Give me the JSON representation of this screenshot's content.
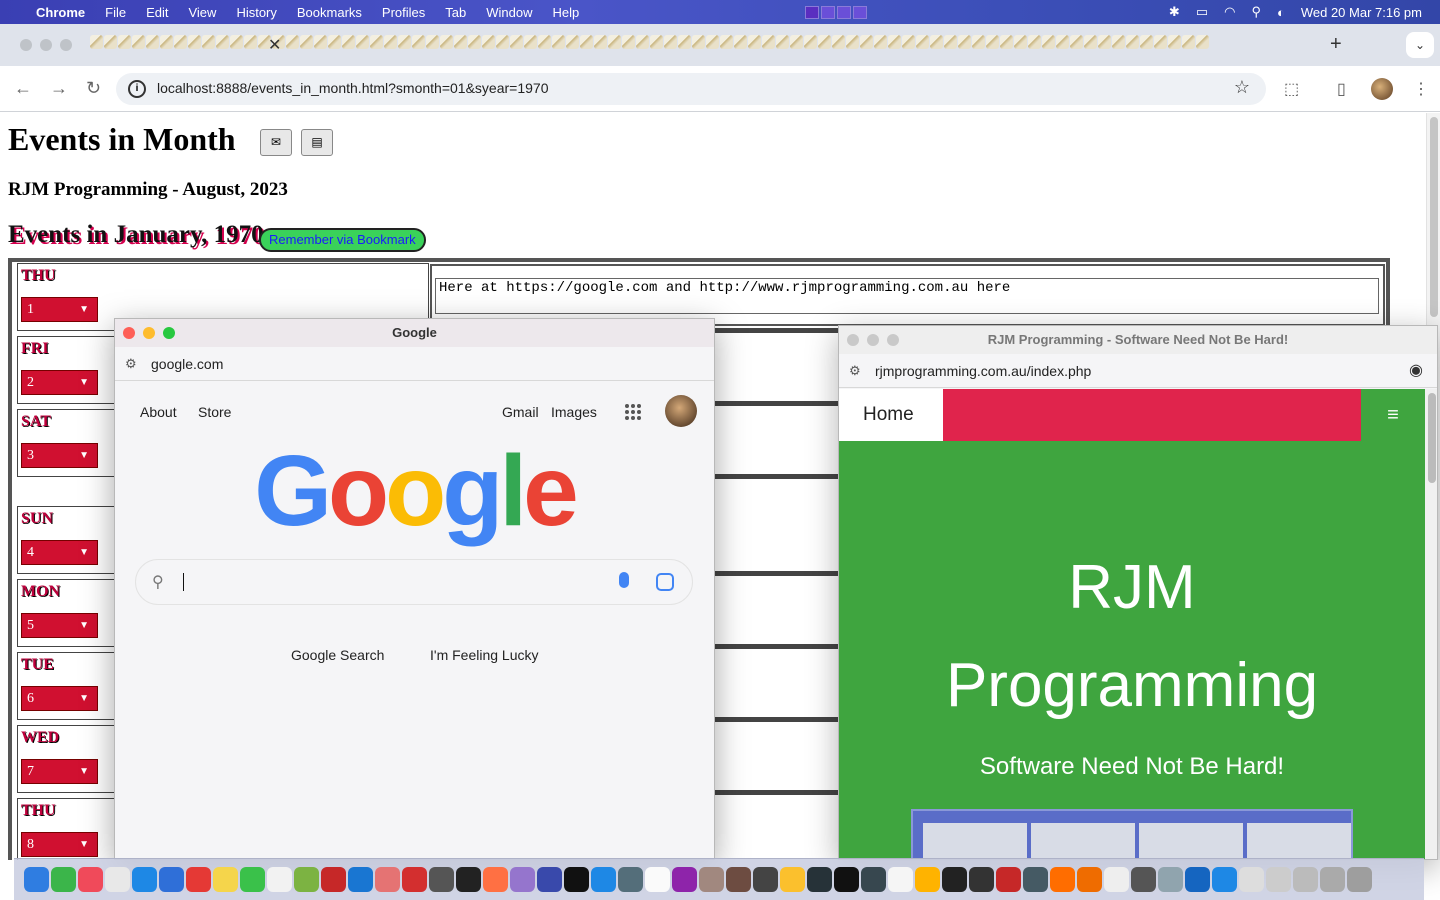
{
  "menubar": {
    "app": "Chrome",
    "items": [
      "File",
      "Edit",
      "View",
      "History",
      "Bookmarks",
      "Profiles",
      "Tab",
      "Window",
      "Help"
    ],
    "datetime": "Wed 20 Mar  7:16 pm"
  },
  "browser": {
    "url": "localhost:8888/events_in_month.html?smonth=01&syear=1970"
  },
  "page": {
    "title": "Events in Month",
    "subtitle": "RJM Programming - August, 2023",
    "events_heading": "Events in January, 1970",
    "bookmark_button": "Remember via Bookmark",
    "days": [
      {
        "dow": "THU",
        "num": "1"
      },
      {
        "dow": "FRI",
        "num": "2"
      },
      {
        "dow": "SAT",
        "num": "3"
      },
      {
        "dow": "SUN",
        "num": "4"
      },
      {
        "dow": "MON",
        "num": "5"
      },
      {
        "dow": "TUE",
        "num": "6"
      },
      {
        "dow": "WED",
        "num": "7"
      },
      {
        "dow": "THU",
        "num": "8"
      }
    ],
    "first_event_text": "Here at https://google.com and http://www.rjmprogramming.com.au here"
  },
  "google_window": {
    "title": "Google",
    "url": "google.com",
    "links": {
      "about": "About",
      "store": "Store",
      "gmail": "Gmail",
      "images": "Images"
    },
    "logo": [
      "G",
      "o",
      "o",
      "g",
      "l",
      "e"
    ],
    "logo_colors": [
      "#4285f4",
      "#ea4335",
      "#fbbc05",
      "#4285f4",
      "#34a853",
      "#ea4335"
    ],
    "search_button": "Google Search",
    "lucky_button": "I'm Feeling Lucky"
  },
  "rjm_window": {
    "title": "RJM Programming - Software Need Not Be Hard!",
    "url": "rjmprogramming.com.au/index.php",
    "nav_home": "Home",
    "heading_line1": "RJM",
    "heading_line2": "Programming",
    "tagline": "Software Need Not Be Hard!"
  },
  "icons": {
    "menu_apple": "apple-icon",
    "hamburger": "≡"
  }
}
